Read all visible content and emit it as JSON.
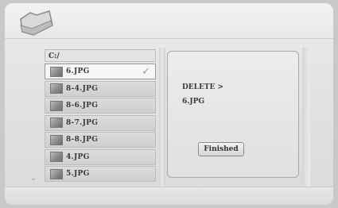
{
  "path": "C:/",
  "files": [
    {
      "name": "6.JPG",
      "selected": true
    },
    {
      "name": "8-4.JPG",
      "selected": false
    },
    {
      "name": "8-6.JPG",
      "selected": false
    },
    {
      "name": "8-7.JPG",
      "selected": false
    },
    {
      "name": "8-8.JPG",
      "selected": false
    },
    {
      "name": "4.JPG",
      "selected": false
    },
    {
      "name": "5.JPG",
      "selected": false
    }
  ],
  "dialog": {
    "action_text": "DELETE >",
    "target_file": "6.JPG",
    "button_label": "Finished"
  },
  "icons": {
    "header": "folder-icon",
    "selected_mark": "checkmark-icon",
    "scroll": "chevron-down-icon",
    "file": "image-thumbnail-icon"
  },
  "colors": {
    "background": "#e3e3e3",
    "row": "#d5d5d5",
    "selected_row": "#f6f6f6",
    "text": "#3a3a3a"
  }
}
